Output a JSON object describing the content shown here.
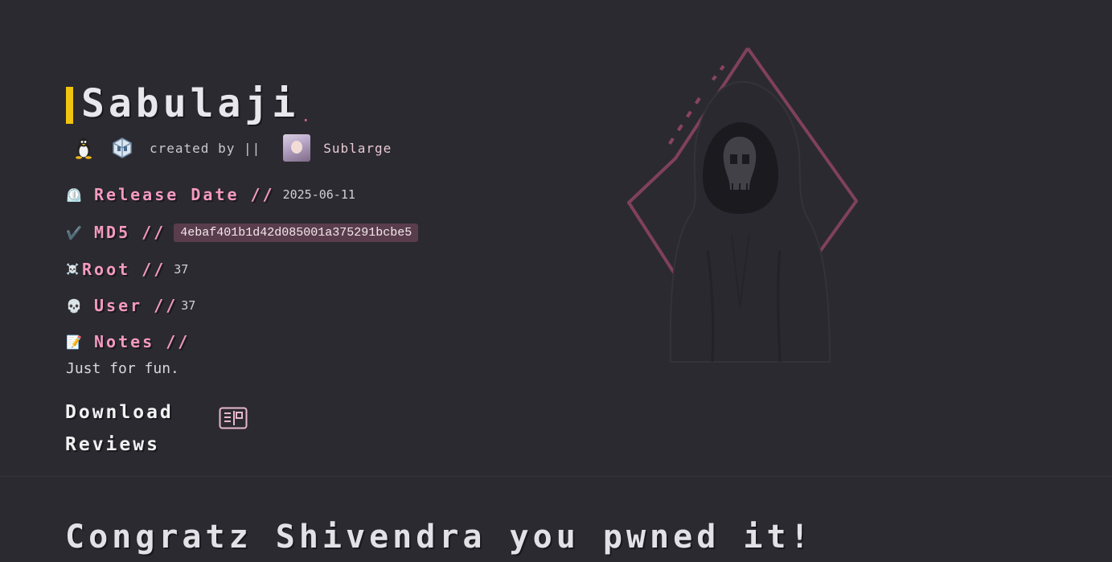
{
  "machine": {
    "title": "Sabulaji",
    "title_suffix": ".",
    "created_by": "created by ||",
    "author": "Sublarge",
    "platform_icons": [
      "linux-penguin-icon",
      "virtualbox-icon"
    ]
  },
  "details": {
    "release": {
      "emoji": "⏲️",
      "label": "Release Date",
      "sep": "//",
      "value": "2025-06-11"
    },
    "md5": {
      "emoji": "✔️",
      "label": "MD5",
      "sep": "//",
      "value": "4ebaf401b1d42d085001a375291bcbe5"
    },
    "root": {
      "emoji": "☠️",
      "label": "Root",
      "sep": "//",
      "value": "37"
    },
    "user": {
      "emoji": "💀",
      "label": "User",
      "sep": "//",
      "value": "37"
    },
    "notes": {
      "emoji": "📝",
      "label": "Notes",
      "sep": "//",
      "value": "Just for fun."
    }
  },
  "actions": {
    "download": "Download",
    "reviews": "Reviews",
    "vm_icon": "vm-box-icon"
  },
  "banner": {
    "text": "Congratz Shivendra you pwned it!"
  },
  "colors": {
    "background": "#2b2a30",
    "accent_yellow": "#f1c40f",
    "label_pink": "#f49ac1",
    "badge_bg": "#5a3d4c",
    "diamond": "#8a4460"
  }
}
